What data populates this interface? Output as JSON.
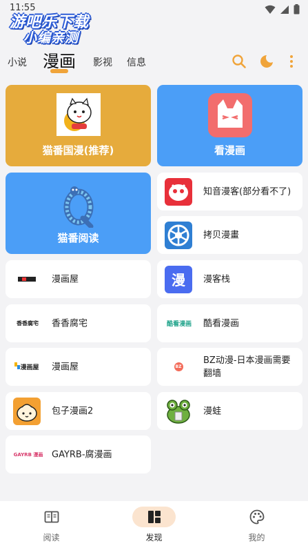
{
  "status": {
    "time": "11:55"
  },
  "watermark": {
    "line1": "游吧乐下载",
    "line2": "小编亲测"
  },
  "tabs": [
    {
      "label": "小说"
    },
    {
      "label": "漫画"
    },
    {
      "label": "影视"
    },
    {
      "label": "信息"
    }
  ],
  "header_icons": [
    "search-icon",
    "moon-icon",
    "more-vert-icon"
  ],
  "colors": {
    "accent": "#f0a43a",
    "card_orange": "#e6ab3c",
    "card_blue": "#4b9ef7"
  },
  "sources": {
    "maofan_guoman": "猫番国漫(推荐)",
    "kan_manhua": "看漫画",
    "maofan_yuedu": "猫番阅读",
    "zhiyin": "知音漫客(部分看不了)",
    "kaobei": "拷贝漫畫",
    "manhuawu1": "漫画屋",
    "mankezhan": "漫客栈",
    "xiangxiang": "香香腐宅",
    "kukan": "酷看漫画",
    "manhuawu2": "漫画屋",
    "bz": "BZ动漫-日本漫画需要翻墙",
    "baozi": "包子漫画2",
    "manwa": "漫蛙",
    "gayrb": "GAYRB-腐漫画"
  },
  "icon_text": {
    "mankezhan": "漫",
    "xiangxiang": "香香腐宅",
    "kukan": "酷看漫画",
    "manhuawu2": "漫画屋",
    "bz": "BZ",
    "gayrb": "GAYRB 漫画"
  },
  "bottom_nav": [
    {
      "label": "阅读"
    },
    {
      "label": "发现"
    },
    {
      "label": "我的"
    }
  ]
}
